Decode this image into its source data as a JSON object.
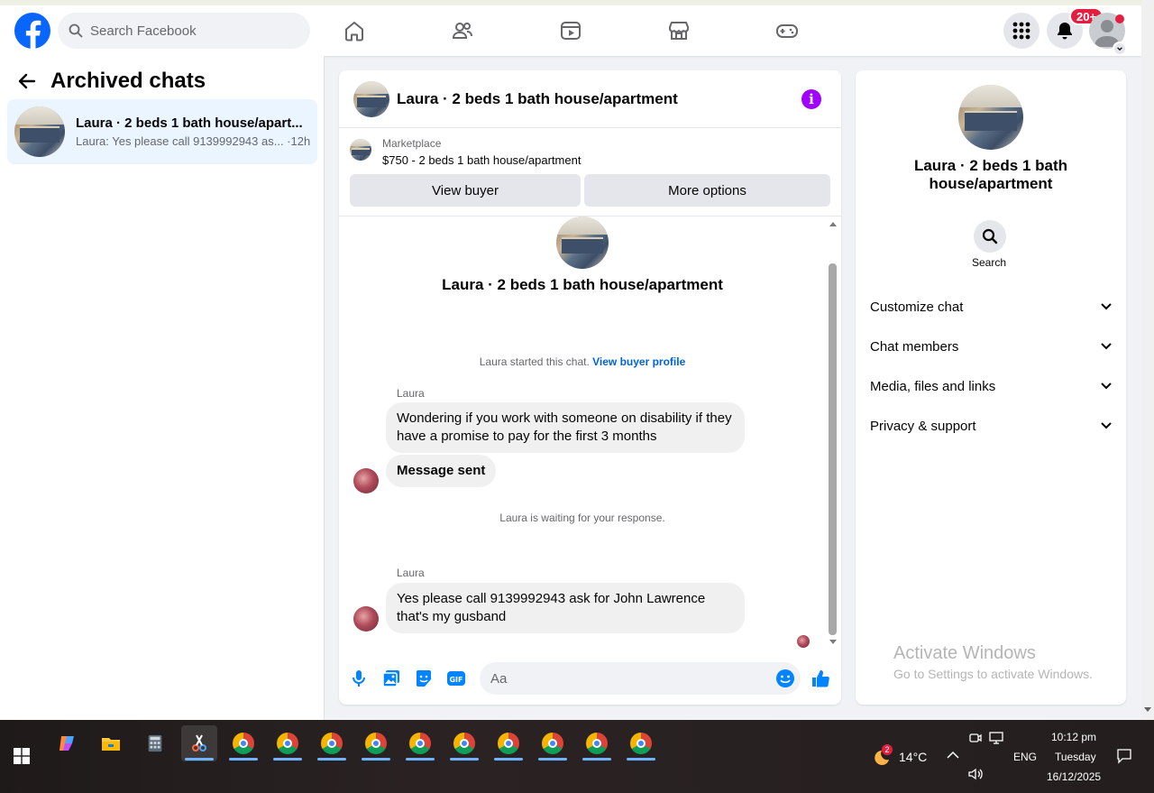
{
  "topnav": {
    "search_placeholder": "Search Facebook",
    "notification_badge": "20+"
  },
  "left": {
    "title": "Archived chats",
    "chat": {
      "name": "Laura · 2 beds 1 bath house/apart...",
      "preview": "Laura: Yes please call 9139992943 as... ·12h"
    }
  },
  "chat": {
    "header_name": "Laura · 2 beds 1 bath house/apartment",
    "info_glyph": "i",
    "marketplace_label": "Marketplace",
    "listing": "$750 - 2 beds 1 bath house/apartment",
    "view_buyer": "View buyer",
    "more_options": "More options",
    "intro_name": "Laura · 2 beds 1 bath house/apartment",
    "started_text": "Laura started this chat. ",
    "view_profile_link": "View buyer profile",
    "sender1": "Laura",
    "msg1": "Wondering if you work with someone on disability if they have a promise to pay for the first 3 months",
    "msg2": "Message sent",
    "waiting": "Laura is waiting for your response.",
    "sender2": "Laura",
    "msg3": "Yes please call 9139992943 ask for John Lawrence that's my gusband",
    "composer_placeholder": "Aa"
  },
  "right": {
    "name": "Laura · 2 beds 1 bath house/apartment",
    "search_label": "Search",
    "sections": [
      "Customize chat",
      "Chat members",
      "Media, files and links",
      "Privacy & support"
    ],
    "watermark_title": "Activate Windows",
    "watermark_sub": "Go to Settings to activate Windows."
  },
  "taskbar": {
    "weather_temp": "14°C",
    "weather_badge": "2",
    "lang": "ENG",
    "time": "10:12 pm",
    "day": "Tuesday",
    "date": "16/12/2025"
  },
  "colors": {
    "brand": "#0866ff",
    "messenger_accent": "#0084ff",
    "info": "#a100ff",
    "badge": "#e41e3f"
  }
}
